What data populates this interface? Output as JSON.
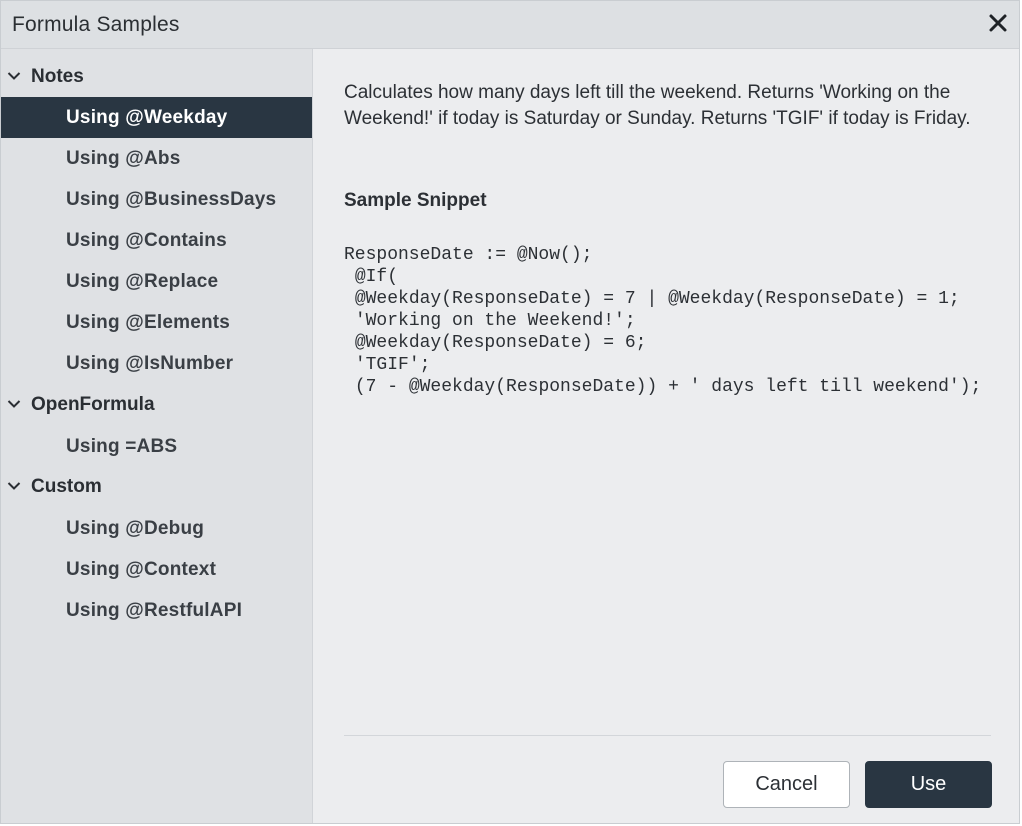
{
  "dialog": {
    "title": "Formula Samples",
    "close_icon": "close-icon"
  },
  "sidebar": {
    "groups": [
      {
        "label": "Notes",
        "icon": "chevron-down-icon",
        "items": [
          {
            "label": "Using @Weekday",
            "selected": true
          },
          {
            "label": "Using @Abs"
          },
          {
            "label": "Using @BusinessDays"
          },
          {
            "label": "Using @Contains"
          },
          {
            "label": "Using @Replace"
          },
          {
            "label": "Using @Elements"
          },
          {
            "label": "Using @IsNumber"
          }
        ]
      },
      {
        "label": "OpenFormula",
        "icon": "chevron-down-icon",
        "items": [
          {
            "label": "Using =ABS"
          }
        ]
      },
      {
        "label": "Custom",
        "icon": "chevron-down-icon",
        "items": [
          {
            "label": "Using @Debug"
          },
          {
            "label": "Using @Context"
          },
          {
            "label": "Using @RestfulAPI"
          }
        ]
      }
    ]
  },
  "detail": {
    "description": "Calculates how many days left till the weekend. Returns 'Working on the Weekend!' if today is Saturday or Sunday. Returns 'TGIF' if today is Friday.",
    "snippet_title": "Sample Snippet",
    "code": "ResponseDate := @Now();\n @If(\n @Weekday(ResponseDate) = 7 | @Weekday(ResponseDate) = 1;\n 'Working on the Weekend!';\n @Weekday(ResponseDate) = 6;\n 'TGIF';\n (7 - @Weekday(ResponseDate)) + ' days left till weekend');"
  },
  "footer": {
    "cancel_label": "Cancel",
    "use_label": "Use"
  },
  "colors": {
    "accent": "#293642",
    "sidebar_bg": "#dfe1e4",
    "content_bg": "#ecedef",
    "titlebar_bg": "#dde0e3"
  }
}
